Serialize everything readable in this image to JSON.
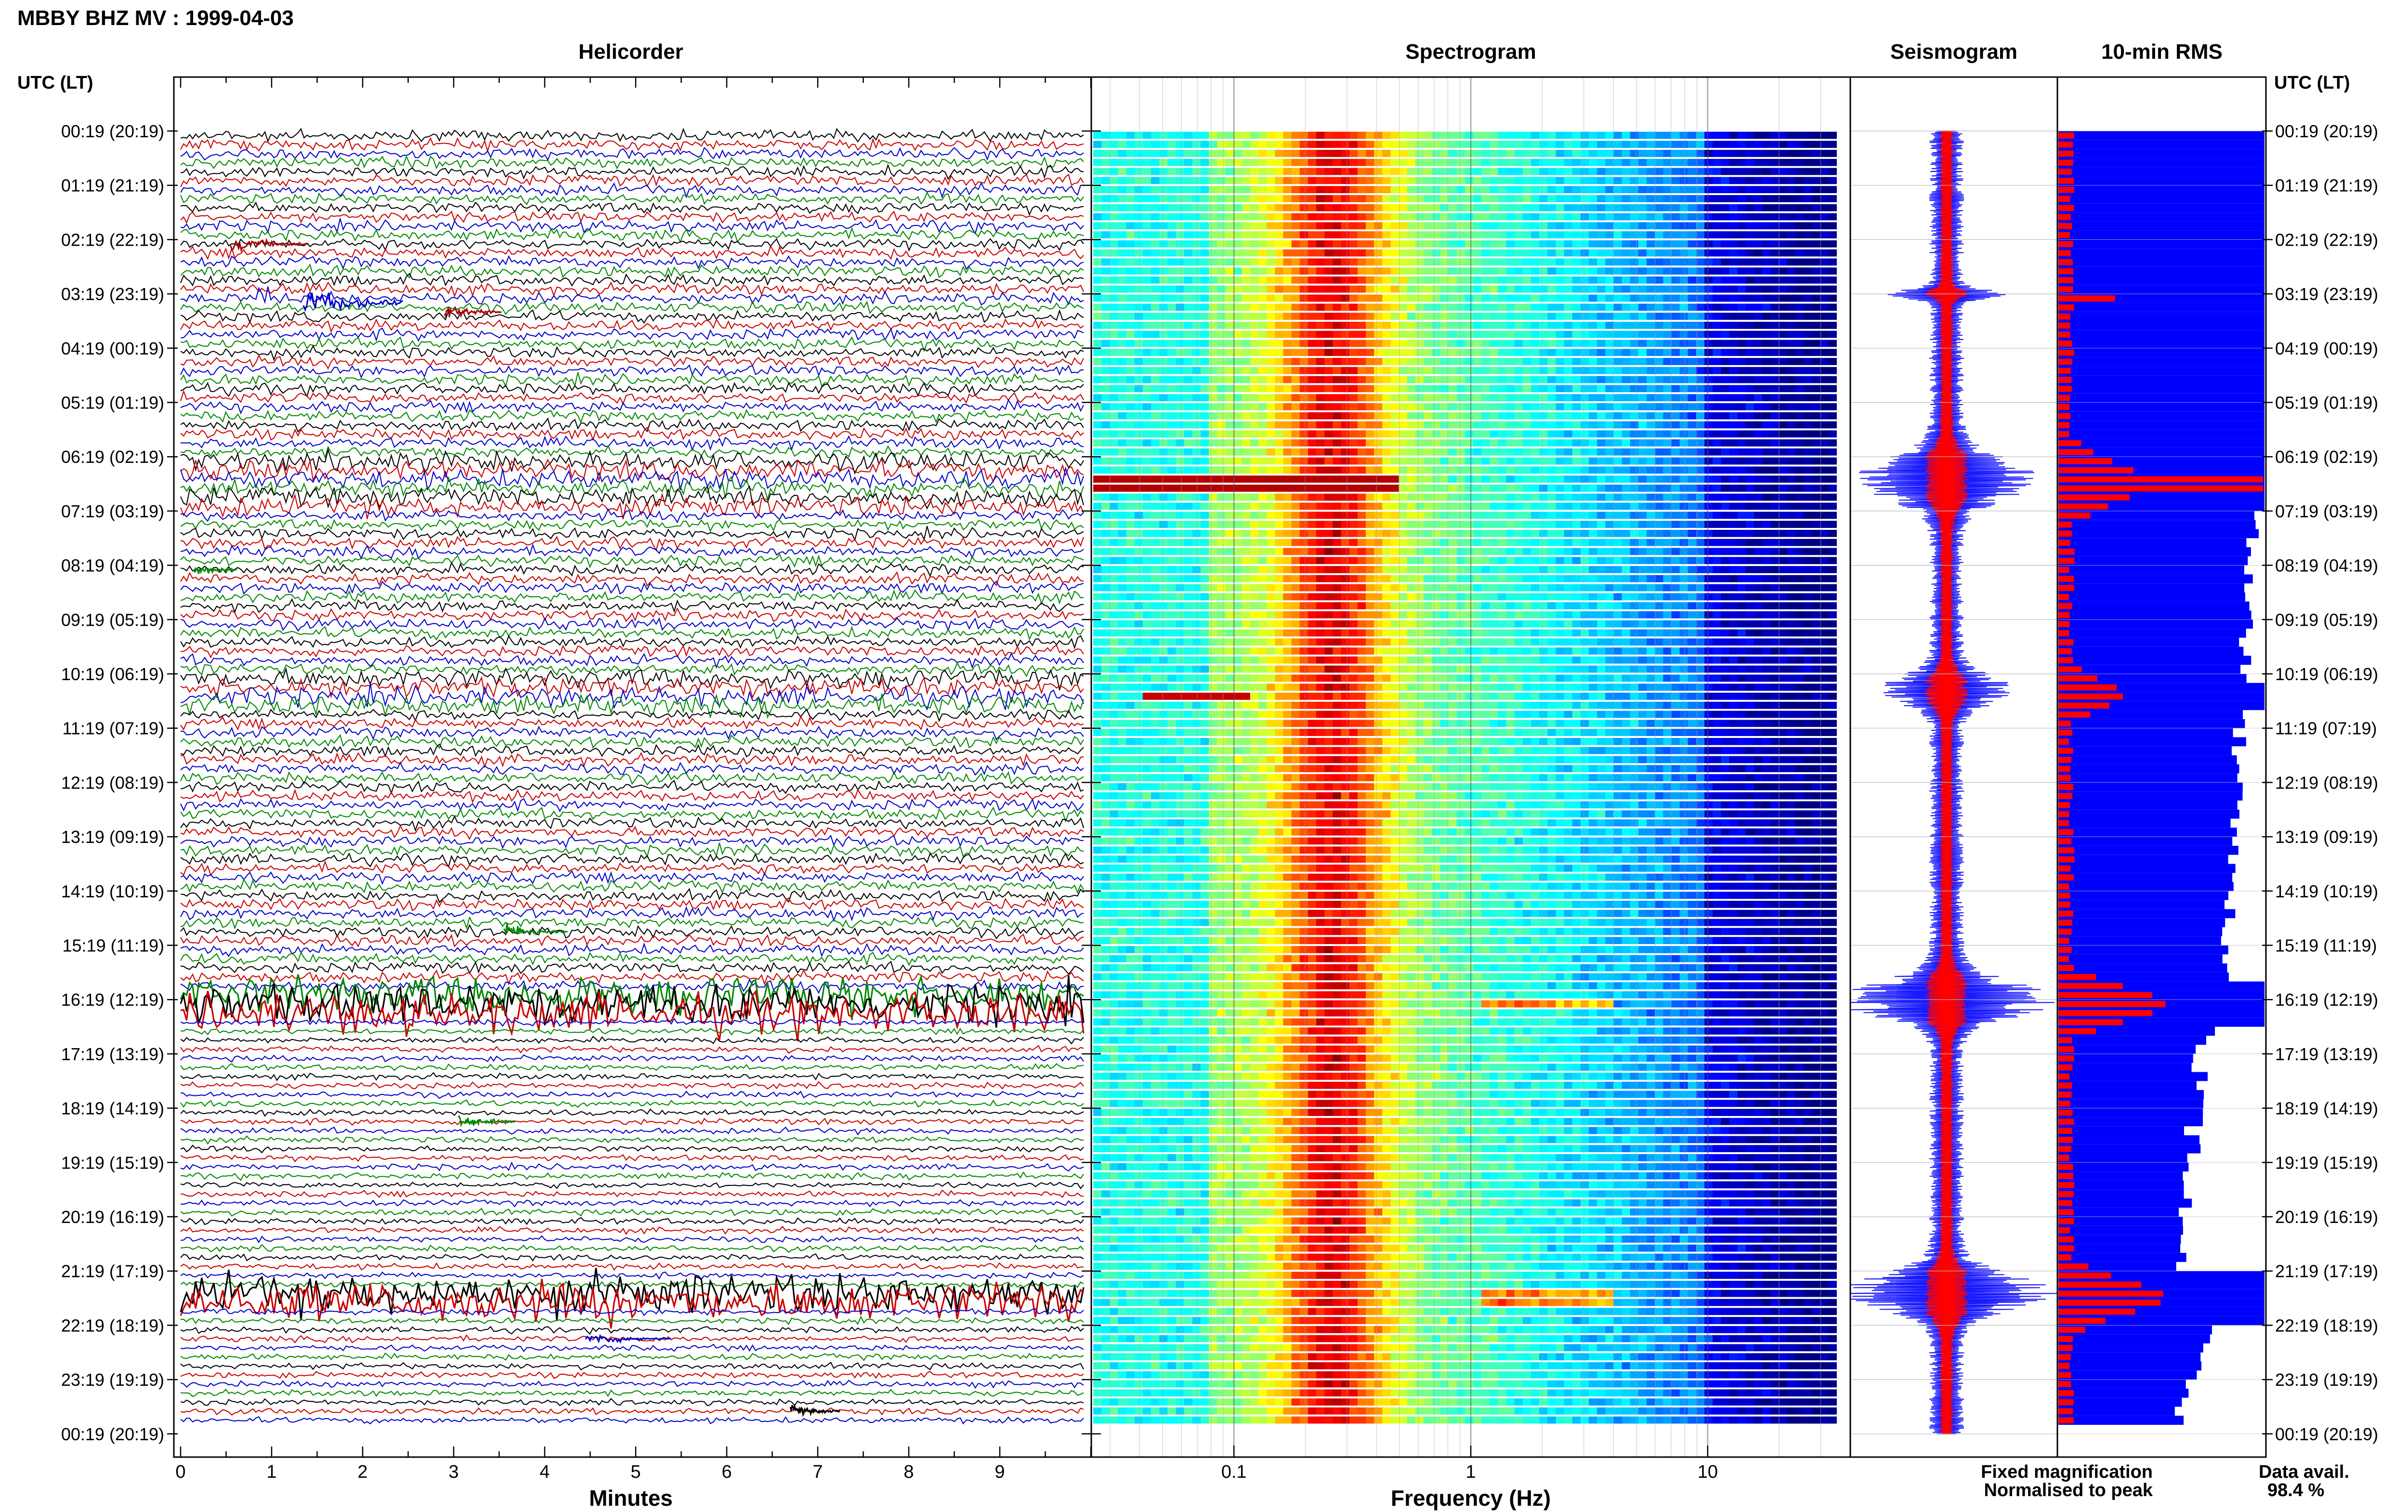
{
  "header": {
    "title": "MBBY BHZ MV : 1999-04-03"
  },
  "panels": {
    "helicorder": "Helicorder",
    "spectrogram": "Spectrogram",
    "seismogram": "Seismogram",
    "rms": "10-min RMS"
  },
  "axis": {
    "left_header": "UTC (LT)",
    "right_header": "UTC (LT)",
    "x_minutes": "Minutes",
    "x_frequency": "Frequency (Hz)"
  },
  "legend": {
    "fixed": "Fixed magnification",
    "normalised": "Normalised to peak",
    "fixed_color": "#1a1aff",
    "normalised_color": "#ff0000"
  },
  "availability": {
    "label": "Data avail.",
    "value": "98.4 %"
  },
  "chart_data": {
    "type": "heatmap",
    "time_labels": [
      "00:19 (20:19)",
      "01:19 (21:19)",
      "02:19 (22:19)",
      "03:19 (23:19)",
      "04:19 (00:19)",
      "05:19 (01:19)",
      "06:19 (02:19)",
      "07:19 (03:19)",
      "08:19 (04:19)",
      "09:19 (05:19)",
      "10:19 (06:19)",
      "11:19 (07:19)",
      "12:19 (08:19)",
      "13:19 (09:19)",
      "14:19 (10:19)",
      "15:19 (11:19)",
      "16:19 (12:19)",
      "17:19 (13:19)",
      "18:19 (14:19)",
      "19:19 (15:19)",
      "20:19 (16:19)",
      "21:19 (17:19)",
      "22:19 (18:19)",
      "23:19 (19:19)",
      "00:19 (20:19)"
    ],
    "minutes_ticks": [
      0,
      1,
      2,
      3,
      4,
      5,
      6,
      7,
      8,
      9
    ],
    "minutes_range": [
      0,
      10
    ],
    "frequency_ticks": [
      0.1,
      1,
      10
    ],
    "frequency_tick_labels": [
      "0.1",
      "1",
      "10"
    ],
    "frequency_range": [
      0.025,
      40
    ],
    "frequency_scale": "log",
    "trace_colors": [
      "#000000",
      "#cc0000",
      "#0000cc",
      "#008800"
    ],
    "events": [
      {
        "hour": 3.0,
        "minute": 1.3,
        "color": "blue"
      },
      {
        "hour": 6.4,
        "minute": 0,
        "color": "broadband"
      },
      {
        "hour": 10.3,
        "minute": 0,
        "color": "broadband"
      },
      {
        "hour": 16.0,
        "minute": 0,
        "color": "broadband"
      },
      {
        "hour": 21.4,
        "minute": 0,
        "color": "broadband"
      }
    ]
  }
}
